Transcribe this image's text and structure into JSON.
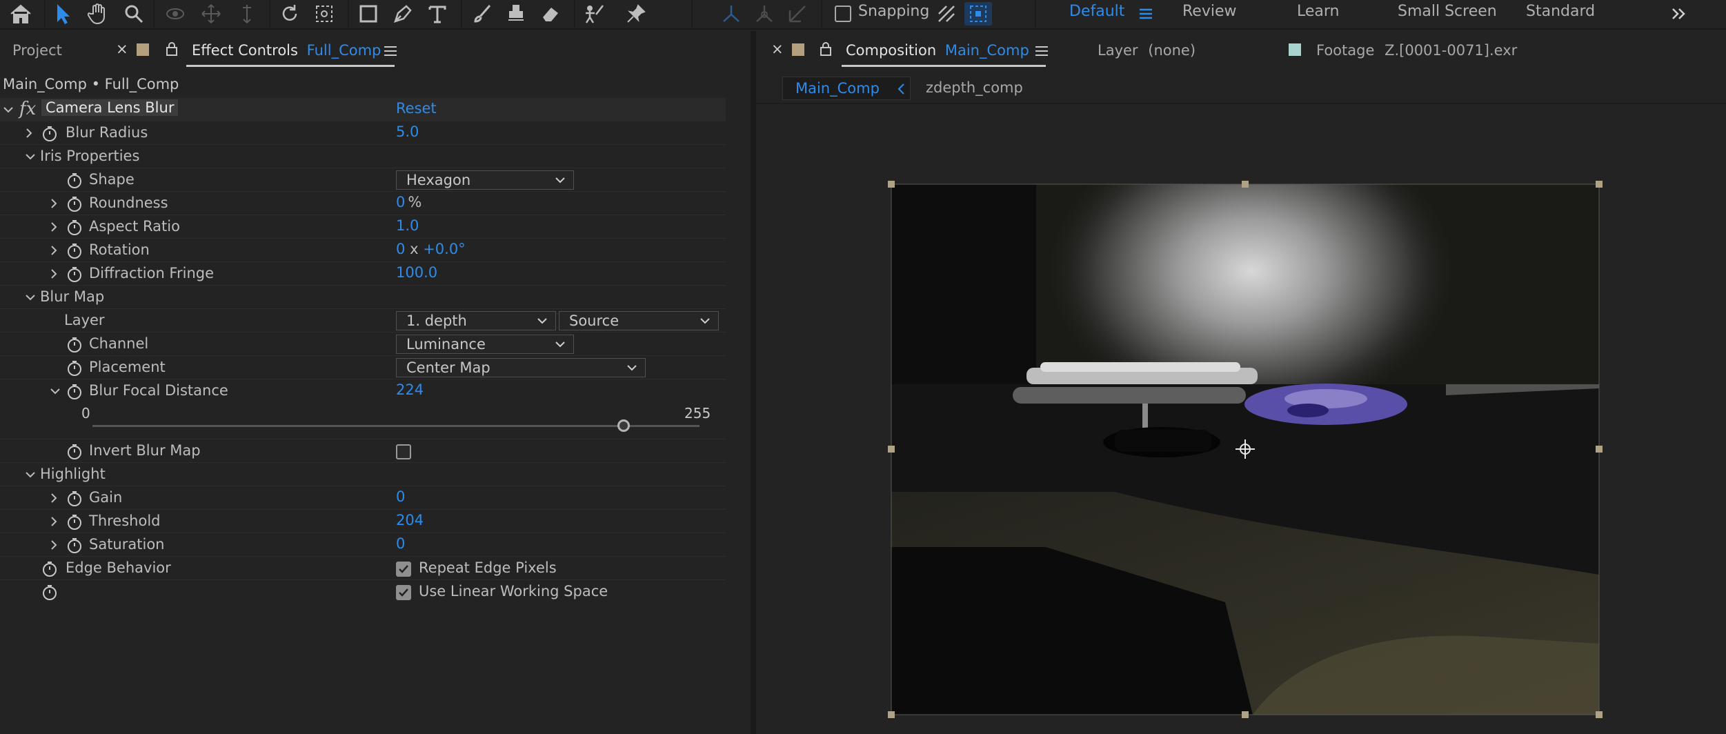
{
  "toolbar": {
    "snapping_label": "Snapping",
    "workspaces": [
      "Default",
      "Review",
      "Learn",
      "Small Screen",
      "Standard"
    ],
    "active_workspace": "Default",
    "accent": "#2d8ceb"
  },
  "left_panel": {
    "tab_project": "Project",
    "tab_effect_controls": "Effect Controls",
    "tab_effect_controls_comp": "Full_Comp",
    "breadcrumb": "Main_Comp • Full_Comp",
    "effect": {
      "name": "Camera Lens Blur",
      "reset_label": "Reset",
      "blur_radius": {
        "label": "Blur Radius",
        "value": "5.0"
      },
      "iris_properties": {
        "label": "Iris Properties",
        "shape": {
          "label": "Shape",
          "value": "Hexagon"
        },
        "roundness": {
          "label": "Roundness",
          "value": "0",
          "unit": "%"
        },
        "aspect_ratio": {
          "label": "Aspect Ratio",
          "value": "1.0"
        },
        "rotation": {
          "label": "Rotation",
          "value_rev": "0",
          "x": "x",
          "value_deg": "+0.0°"
        },
        "diffraction_fringe": {
          "label": "Diffraction Fringe",
          "value": "100.0"
        }
      },
      "blur_map": {
        "label": "Blur Map",
        "layer": {
          "label": "Layer",
          "value": "1. depth",
          "source": "Source"
        },
        "channel": {
          "label": "Channel",
          "value": "Luminance"
        },
        "placement": {
          "label": "Placement",
          "value": "Center Map"
        },
        "blur_focal_distance": {
          "label": "Blur Focal Distance",
          "value": "224",
          "min": "0",
          "max": "255",
          "level": 224
        },
        "invert_blur_map": {
          "label": "Invert Blur Map",
          "checked": false
        }
      },
      "highlight": {
        "label": "Highlight",
        "gain": {
          "label": "Gain",
          "value": "0"
        },
        "threshold": {
          "label": "Threshold",
          "value": "204"
        },
        "saturation": {
          "label": "Saturation",
          "value": "0"
        }
      },
      "edge_behavior": {
        "label": "Edge Behavior",
        "option": "Repeat Edge Pixels",
        "checked": true
      },
      "linear_working_space": {
        "option": "Use Linear Working Space",
        "checked": true
      }
    }
  },
  "right_panel": {
    "tab_composition": "Composition",
    "tab_composition_name": "Main_Comp",
    "tab_layer": "Layer",
    "tab_layer_value": "(none)",
    "tab_footage": "Footage",
    "tab_footage_value": "Z.[0001-0071].exr",
    "flowchart_active": "Main_Comp",
    "flowchart_next": "zdepth_comp"
  }
}
